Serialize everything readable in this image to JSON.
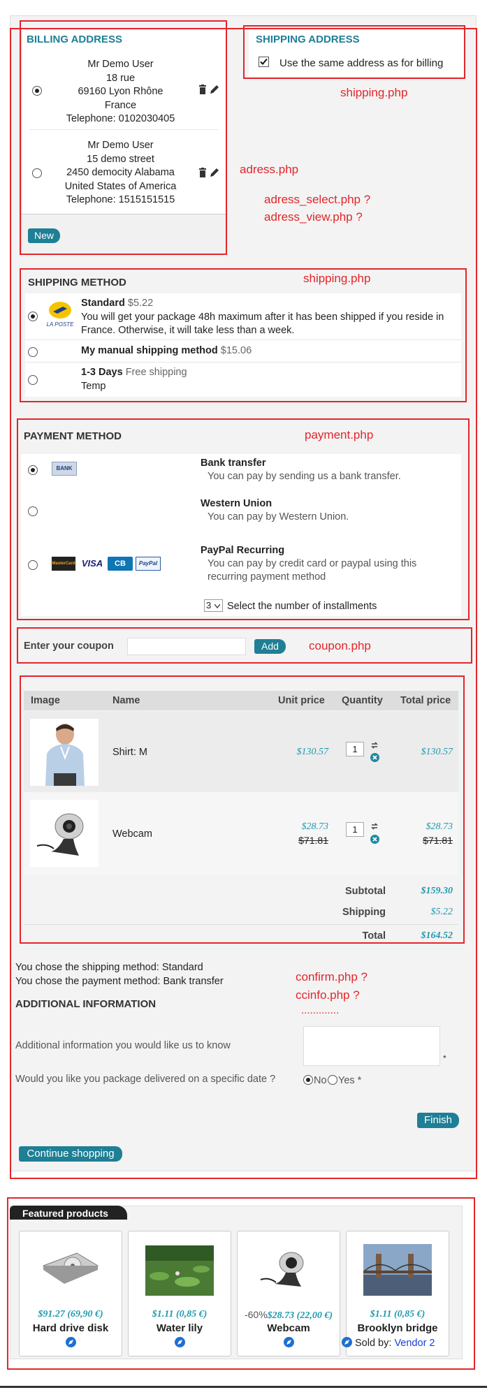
{
  "billing": {
    "title": "BILLING ADDRESS",
    "addresses": [
      {
        "lines": [
          "Mr Demo User",
          "18 rue",
          "69160 Lyon Rhône",
          "France",
          "Telephone: 0102030405"
        ]
      },
      {
        "lines": [
          "Mr Demo User",
          "15 demo street",
          "2450 democity Alabama",
          "United States of America",
          "Telephone: 1515151515"
        ]
      }
    ],
    "new_label": "New"
  },
  "shipping_address": {
    "title": "SHIPPING ADDRESS",
    "same_label": "Use the same address as for billing"
  },
  "shipping_method": {
    "title": "SHIPPING METHOD",
    "logo_text": "LA POSTE",
    "options": [
      {
        "name": "Standard",
        "price": "$5.22",
        "desc": "You will get your package 48h maximum after it has been shipped if you reside in France. Otherwise, it will take less than a week."
      },
      {
        "name": "My manual shipping method",
        "price": "$15.06",
        "desc": ""
      },
      {
        "name": "1-3 Days",
        "price": "Free shipping",
        "desc": "Temp"
      }
    ]
  },
  "payment_method": {
    "title": "PAYMENT METHOD",
    "bank_logo": "BANK",
    "card_logos": [
      "MasterCard",
      "VISA",
      "CB",
      "PayPal"
    ],
    "options": [
      {
        "name": "Bank transfer",
        "desc": "You can pay by sending us a bank transfer."
      },
      {
        "name": "Western Union",
        "desc": "You can pay by Western Union."
      },
      {
        "name": "PayPal Recurring",
        "desc": "You can pay by credit card or paypal using this recurring payment method"
      }
    ],
    "installments_value": "3",
    "installments_label": "Select the number of installments"
  },
  "coupon": {
    "label": "Enter your coupon",
    "placeholder": "",
    "button": "Add"
  },
  "cart": {
    "headers": [
      "Image",
      "Name",
      "Unit price",
      "Quantity",
      "Total price"
    ],
    "rows": [
      {
        "name": "Shirt: M",
        "unit_price": "$130.57",
        "unit_old": "",
        "qty": "1",
        "total": "$130.57",
        "total_old": ""
      },
      {
        "name": "Webcam",
        "unit_price": "$28.73",
        "unit_old": "$71.81",
        "qty": "1",
        "total": "$28.73",
        "total_old": "$71.81"
      }
    ],
    "subtotal_label": "Subtotal",
    "subtotal": "$159.30",
    "shipping_label": "Shipping",
    "shipping": "$5.22",
    "total_label": "Total",
    "total": "$164.52"
  },
  "confirm": {
    "chosen_shipping": "You chose the shipping method: Standard",
    "chosen_payment": "You chose the payment method: Bank transfer",
    "additional_title": "ADDITIONAL INFORMATION",
    "info_label": "Additional information you would like us to know",
    "date_label": "Would you like you package delivered on a specific date ?",
    "no_label": "No",
    "yes_label": "Yes *",
    "finish": "Finish",
    "continue": "Continue shopping"
  },
  "annotations": {
    "shipping1": "shipping.php",
    "adress": "adress.php",
    "adress_select": "adress_select.php ?",
    "adress_view": "adress_view.php  ?",
    "shipping2": "shipping.php",
    "payment": "payment.php",
    "coupon": "coupon.php",
    "confirm": "confirm.php ?",
    "ccinfo": "ccinfo.php  ?",
    "dots": "............."
  },
  "featured": {
    "title": "Featured products",
    "products": [
      {
        "price": "$91.27 (69,90 €)",
        "discount": "",
        "name": "Hard drive disk",
        "vendor_label": "",
        "vendor": ""
      },
      {
        "price": "$1.11 (0,85 €)",
        "discount": "",
        "name": "Water lily",
        "vendor_label": "",
        "vendor": ""
      },
      {
        "price": "$28.73 (22,00 €)",
        "discount": "-60%",
        "name": "Webcam",
        "vendor_label": "",
        "vendor": ""
      },
      {
        "price": "$1.11 (0,85 €)",
        "discount": "",
        "name": "Brooklyn bridge",
        "vendor_label": "Sold by:",
        "vendor": "Vendor 2"
      }
    ]
  },
  "colors": {
    "accent": "#1e7f95",
    "annotation": "#e2262b",
    "price": "#1e9ab0"
  }
}
